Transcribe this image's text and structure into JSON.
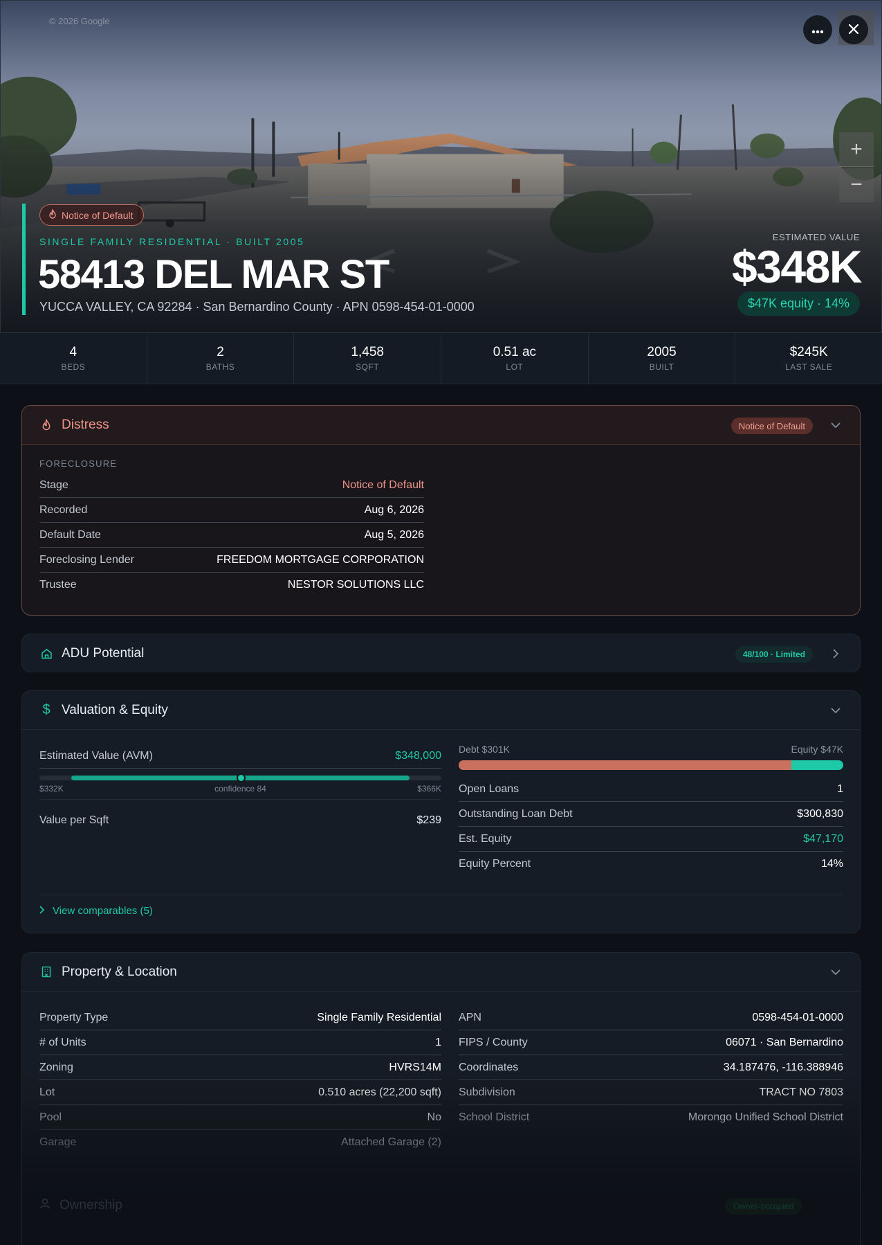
{
  "hero": {
    "watermark": "© 2026 Google",
    "badge": "Notice of Default",
    "eyebrow": "SINGLE FAMILY RESIDENTIAL · BUILT 2005",
    "address": "58413 DEL MAR ST",
    "subaddress": "YUCCA VALLEY, CA 92284 · San Bernardino County · APN 0598-454-01-0000",
    "estimated_label": "ESTIMATED VALUE",
    "estimated_value": "$348K",
    "equity_pill": "$47K equity · 14%",
    "more_icon": "ellipsis-icon",
    "close_icon": "close-icon",
    "zoom_in": "+",
    "zoom_out": "−"
  },
  "stats": [
    {
      "value": "4",
      "label": "BEDS"
    },
    {
      "value": "2",
      "label": "BATHS"
    },
    {
      "value": "1,458",
      "label": "SQFT"
    },
    {
      "value": "0.51 ac",
      "label": "LOT"
    },
    {
      "value": "2005",
      "label": "BUILT"
    },
    {
      "value": "$245K",
      "label": "LAST SALE"
    }
  ],
  "distress": {
    "title": "Distress",
    "badge": "Notice of Default",
    "section": "FORECLOSURE",
    "rows": [
      {
        "k": "Stage",
        "v": "Notice of Default"
      },
      {
        "k": "Recorded",
        "v": "Aug 6, 2026"
      },
      {
        "k": "Default Date",
        "v": "Aug 5, 2026"
      },
      {
        "k": "Foreclosing Lender",
        "v": "FREEDOM MORTGAGE CORPORATION"
      },
      {
        "k": "Trustee",
        "v": "NESTOR SOLUTIONS LLC"
      }
    ],
    "accent": "#f0948a"
  },
  "adu": {
    "title": "ADU Potential",
    "badge": "48/100 · Limited"
  },
  "valuation": {
    "title": "Valuation & Equity",
    "avm_label": "Estimated Value (AVM)",
    "avm_value": "$348,000",
    "range_low": "$332K",
    "range_high": "$366K",
    "confidence": "confidence 84",
    "range_fill_start": 0.08,
    "range_fill_end": 0.92,
    "range_marker": 0.5,
    "vps_label": "Value per Sqft",
    "vps_value": "$239",
    "debt_label": "Debt $301K",
    "equity_label": "Equity $47K",
    "debt_fraction": 0.865,
    "rows": [
      {
        "k": "Open Loans",
        "v": "1"
      },
      {
        "k": "Outstanding Loan Debt",
        "v": "$300,830"
      },
      {
        "k": "Est. Equity",
        "v": "$47,170"
      },
      {
        "k": "Equity Percent",
        "v": "14%"
      }
    ],
    "comparables": "View comparables (5)"
  },
  "property": {
    "title": "Property & Location",
    "left": [
      {
        "k": "Property Type",
        "v": "Single Family Residential"
      },
      {
        "k": "# of Units",
        "v": "1"
      },
      {
        "k": "Zoning",
        "v": "HVRS14M"
      },
      {
        "k": "Lot",
        "v": "0.510 acres (22,200 sqft)"
      },
      {
        "k": "Pool",
        "v": "No"
      },
      {
        "k": "Garage",
        "v": "Attached Garage (2)"
      }
    ],
    "right": [
      {
        "k": "APN",
        "v": "0598-454-01-0000"
      },
      {
        "k": "FIPS / County",
        "v": "06071 · San Bernardino"
      },
      {
        "k": "Coordinates",
        "v": "34.187476, -116.388946"
      },
      {
        "k": "Subdivision",
        "v": "TRACT NO 7803"
      },
      {
        "k": "School District",
        "v": "Morongo Unified School District"
      }
    ]
  },
  "ownership": {
    "title": "Ownership",
    "badge": "Owner-occupied"
  },
  "colors": {
    "accent": "#1ec9a8",
    "distress": "#f0948a",
    "debt": "#c9705f",
    "background": "#0d1117"
  }
}
